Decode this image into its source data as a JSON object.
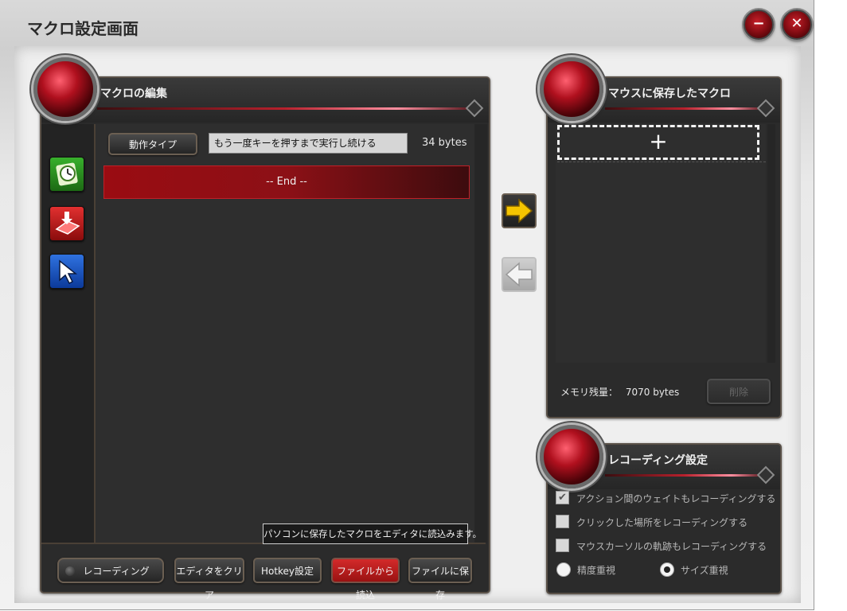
{
  "window": {
    "title": "マクロ設定画面"
  },
  "editor": {
    "title": "マクロの編集",
    "action_type_label": "動作タイプ",
    "action_type_value": "もう一度キーを押すまで実行し続ける",
    "size_text": "34 bytes",
    "end_label": "-- End --",
    "tooltip": "パソコンに保存したマクロをエディタに読込みます。",
    "buttons": {
      "recording": "レコーディング",
      "clear": "エディタをクリア",
      "hotkey": "Hotkey設定",
      "load": "ファイルから読込",
      "save": "ファイルに保存"
    }
  },
  "saved": {
    "title": "マウスに保存したマクロ",
    "add_symbol": "+",
    "memory_label": "メモリ残量：",
    "memory_value": "7070 bytes",
    "delete_label": "削除"
  },
  "recording_settings": {
    "title": "レコーディング設定",
    "options": [
      {
        "label": "アクション間のウェイトもレコーディングする",
        "checked": true
      },
      {
        "label": "クリックした場所をレコーディングする",
        "checked": false
      },
      {
        "label": "マウスカーソルの軌跡もレコーディングする",
        "checked": false
      }
    ],
    "radio": [
      {
        "label": "精度重視",
        "selected": false
      },
      {
        "label": "サイズ重視",
        "selected": true
      }
    ],
    "check_mark": "✔"
  },
  "colors": {
    "accent_red": "#b8101c",
    "arrow_yellow": "#f5c400",
    "panel_bg": "#2b2b2b"
  },
  "icons": [
    "minimize-icon",
    "close-icon",
    "wait-clock-icon",
    "key-down-icon",
    "mouse-cursor-icon",
    "move-right-arrow-icon",
    "move-left-arrow-icon"
  ]
}
